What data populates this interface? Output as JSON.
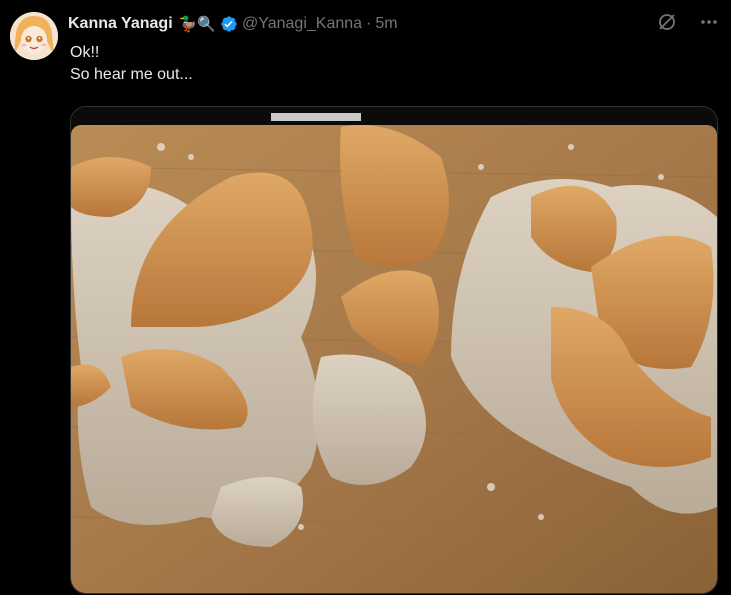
{
  "tweet": {
    "author_name": "Kanna Yanagi",
    "name_emojis": "🦆🔍",
    "handle": "@Yanagi_Kanna",
    "separator": "·",
    "time": "5m",
    "text_lines": [
      "Ok!!",
      "So hear me out..."
    ]
  },
  "icons": {
    "grok": "grok-icon",
    "more": "more-icon",
    "verified": "verified-badge-icon"
  },
  "colors": {
    "background": "#000000",
    "text": "#e7e9ea",
    "muted": "#71767b",
    "verified": "#1d9bf0"
  }
}
